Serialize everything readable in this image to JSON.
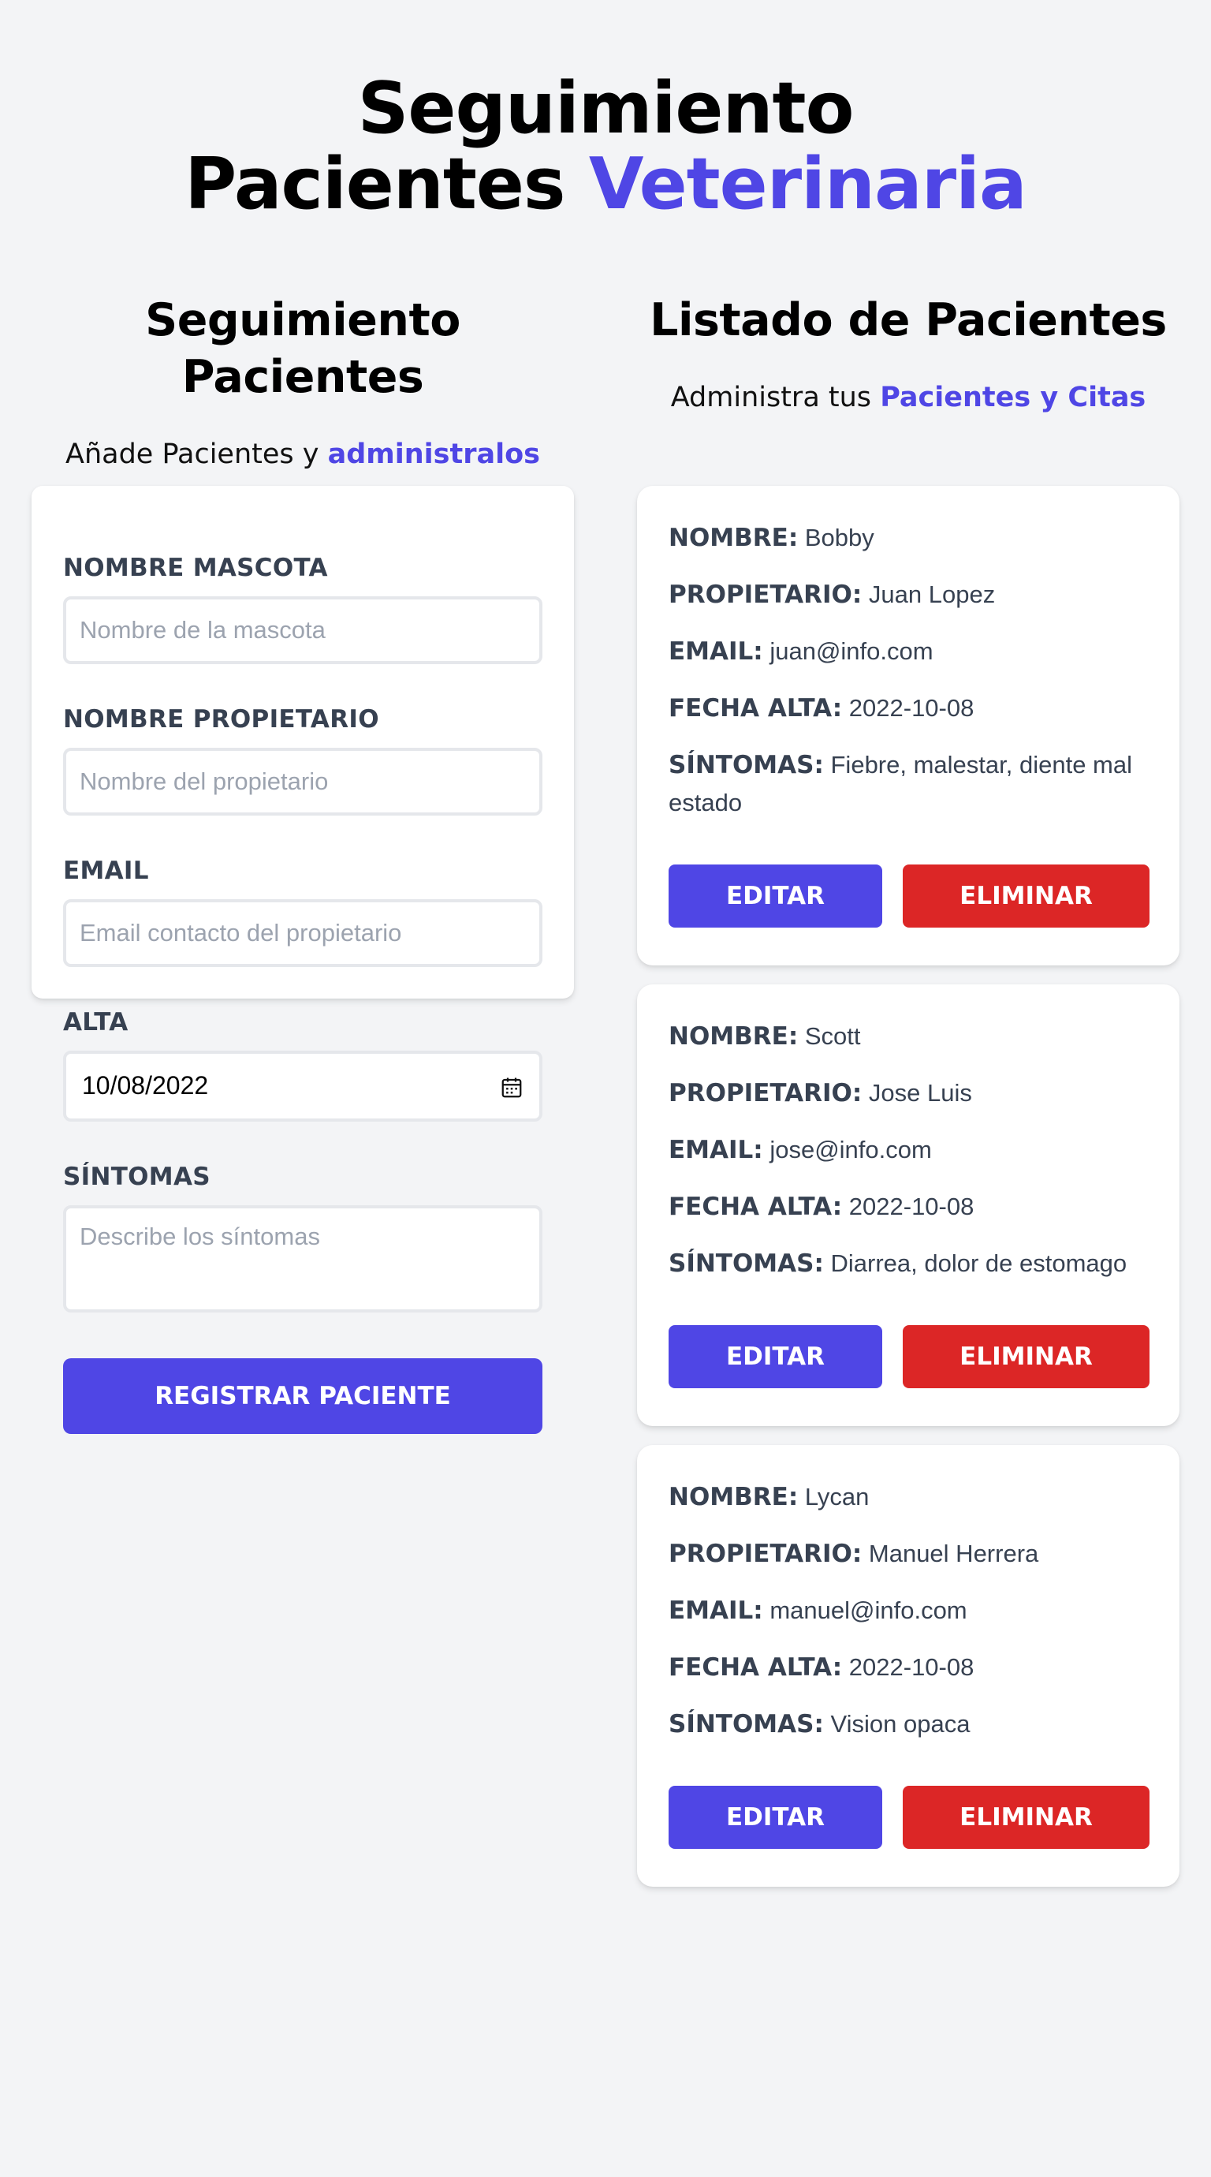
{
  "header": {
    "title_line1": "Seguimiento",
    "title_line2_plain": "Pacientes",
    "title_line2_accent": "Veterinaria"
  },
  "form_section": {
    "title": "Seguimiento Pacientes",
    "subtitle_plain": "Añade Pacientes y",
    "subtitle_accent": "administralos",
    "fields": {
      "pet_name": {
        "label": "NOMBRE MASCOTA",
        "placeholder": "Nombre de la mascota",
        "value": ""
      },
      "owner_name": {
        "label": "NOMBRE PROPIETARIO",
        "placeholder": "Nombre del propietario",
        "value": ""
      },
      "email": {
        "label": "EMAIL",
        "placeholder": "Email contacto del propietario",
        "value": ""
      },
      "alta": {
        "label": "ALTA",
        "value": "10/08/2022"
      },
      "symptoms": {
        "label": "SÍNTOMAS",
        "placeholder": "Describe los síntomas",
        "value": ""
      }
    },
    "submit_label": "REGISTRAR PACIENTE"
  },
  "list_section": {
    "title": "Listado de Pacientes",
    "subtitle_plain": "Administra tus",
    "subtitle_accent": "Pacientes y Citas",
    "labels": {
      "name": "NOMBRE:",
      "owner": "PROPIETARIO:",
      "email": "EMAIL:",
      "date": "FECHA ALTA:",
      "symptoms": "SÍNTOMAS:"
    },
    "edit_label": "EDITAR",
    "delete_label": "ELIMINAR",
    "patients": [
      {
        "name": "Bobby",
        "owner": "Juan Lopez",
        "email": "juan@info.com",
        "date": "2022-10-08",
        "symptoms": "Fiebre, malestar, diente mal estado"
      },
      {
        "name": "Scott",
        "owner": "Jose Luis",
        "email": "jose@info.com",
        "date": "2022-10-08",
        "symptoms": "Diarrea, dolor de estomago"
      },
      {
        "name": "Lycan",
        "owner": "Manuel Herrera",
        "email": "manuel@info.com",
        "date": "2022-10-08",
        "symptoms": "Vision opaca"
      }
    ]
  },
  "colors": {
    "accent": "#4f46e5",
    "danger": "#dc2626",
    "background": "#f3f4f6",
    "label_text": "#374151",
    "placeholder": "#9ca3af"
  }
}
